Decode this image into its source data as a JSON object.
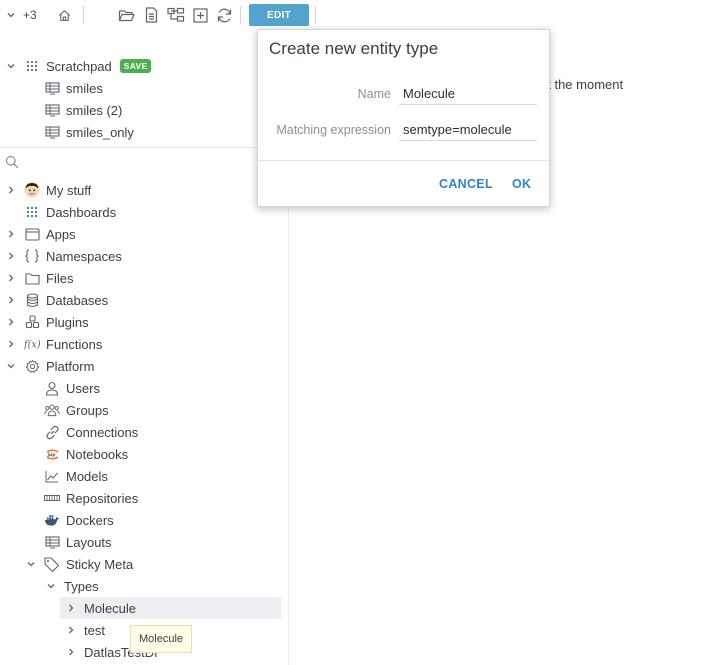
{
  "toolbar": {
    "badge_count": "+3",
    "edit_label": "EDIT",
    "icons": [
      "home-icon",
      "open-folder-icon",
      "document-icon",
      "tree-icon",
      "add-icon",
      "refresh-icon"
    ]
  },
  "scratchpad": {
    "label": "Scratchpad",
    "save_badge": "SAVE",
    "items": [
      {
        "label": "smiles"
      },
      {
        "label": "smiles (2)"
      },
      {
        "label": "smiles_only"
      }
    ]
  },
  "tree": {
    "my_stuff": "My stuff",
    "dashboards": "Dashboards",
    "apps": "Apps",
    "namespaces": "Namespaces",
    "files": "Files",
    "databases": "Databases",
    "plugins": "Plugins",
    "functions": "Functions",
    "platform": "Platform",
    "users": "Users",
    "groups": "Groups",
    "connections": "Connections",
    "notebooks": "Notebooks",
    "models": "Models",
    "repositories": "Repositories",
    "dockers": "Dockers",
    "layouts": "Layouts",
    "sticky_meta": "Sticky Meta",
    "types": "Types",
    "types_items": [
      {
        "label": "Molecule"
      },
      {
        "label": "test"
      },
      {
        "label": "DatlasTestDf"
      }
    ]
  },
  "main": {
    "partial_text": "at the moment"
  },
  "dialog": {
    "title": "Create new entity type",
    "name_label": "Name",
    "name_value": "Molecule",
    "expr_label": "Matching expression",
    "expr_value": "semtype=molecule",
    "cancel": "CANCEL",
    "ok": "OK"
  },
  "tooltip": {
    "text": "Molecule"
  },
  "colors": {
    "edit_button": "#52a4cc",
    "save_badge": "#4caf50",
    "dialog_button": "#2f86c4",
    "selected_row": "#eeeef2",
    "tooltip_bg": "#fffde7"
  }
}
